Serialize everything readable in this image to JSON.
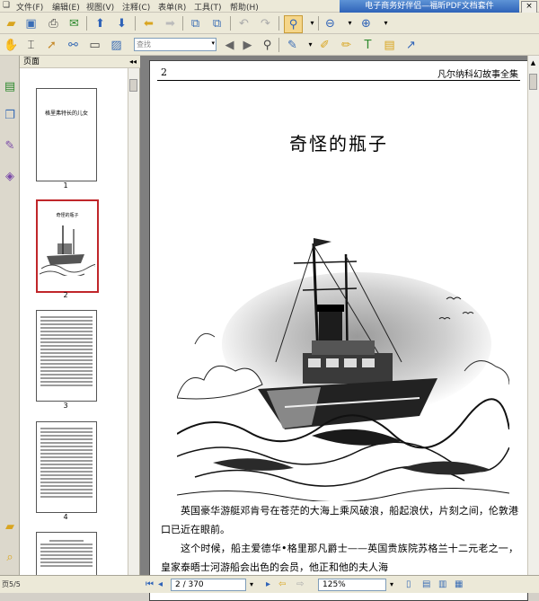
{
  "menu": {
    "items": [
      "文件(F)",
      "编辑(E)",
      "视图(V)",
      "注释(C)",
      "表单(R)",
      "工具(T)",
      "帮助(H)"
    ],
    "app_title": "电子商务好伴侣—福昕PDF文档套件",
    "close": "×"
  },
  "toolbar": {
    "find_placeholder": "查找"
  },
  "thumbnails": {
    "header": "页面",
    "collapse": "◂◂",
    "pages": [
      {
        "num": "1",
        "caption": "格里弗特长的儿女"
      },
      {
        "num": "2",
        "caption": "奇怪的瓶子"
      },
      {
        "num": "3"
      },
      {
        "num": "4"
      }
    ]
  },
  "document": {
    "page_number": "2",
    "running_head": "凡尔纳科幻故事全集",
    "chapter_title": "奇怪的瓶子",
    "paragraphs": [
      "英国豪华游艇邓肯号在苍茫的大海上乘风破浪，船起浪伏，片刻之间，伦敦港口已近在眼前。",
      "这个时候，船主爱德华•格里那凡爵士——英国贵族院苏格兰十二元老之一，皇家泰晤士河游船会出色的会员，他正和他的夫人海"
    ]
  },
  "status": {
    "left_text": "页5/5",
    "page_field": "2 / 370",
    "zoom_field": "125%"
  }
}
